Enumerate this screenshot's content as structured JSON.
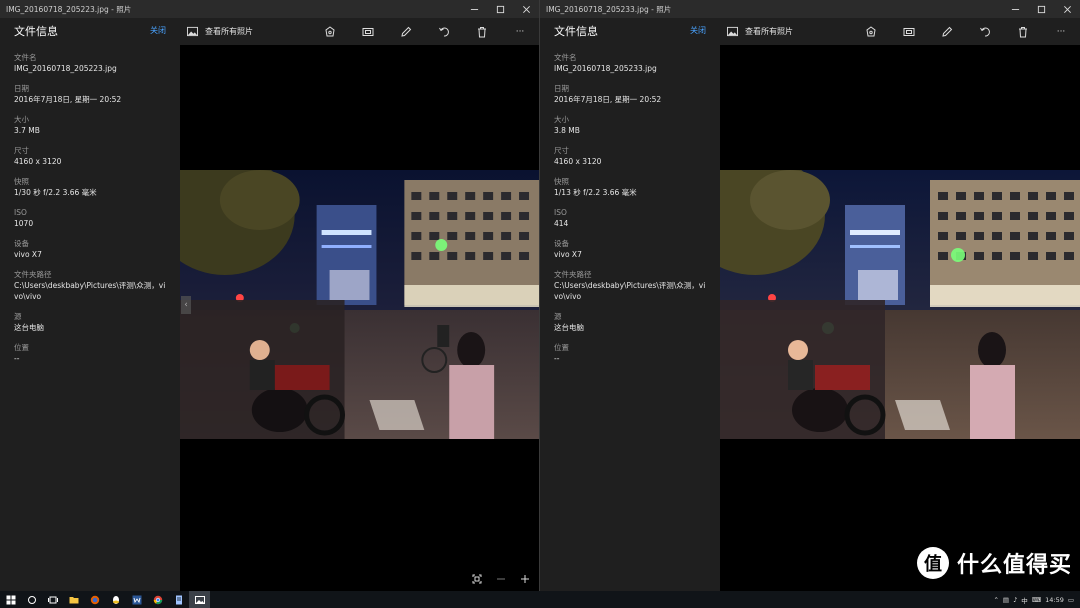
{
  "windows": [
    {
      "title": "IMG_20160718_205223.jpg - 照片",
      "panel_title": "文件信息",
      "close_label": "关闭",
      "view_all_label": "查看所有照片",
      "fields": [
        {
          "label": "文件名",
          "value": "IMG_20160718_205223.jpg"
        },
        {
          "label": "日期",
          "value": "2016年7月18日, 星期一 20:52"
        },
        {
          "label": "大小",
          "value": "3.7 MB"
        },
        {
          "label": "尺寸",
          "value": "4160 x 3120"
        },
        {
          "label": "快照",
          "value": "1/30 秒 f/2.2 3.66 毫米"
        },
        {
          "label": "ISO",
          "value": "1070"
        },
        {
          "label": "设备",
          "value": "vivo X7"
        },
        {
          "label": "文件夹路径",
          "value": "C:\\Users\\deskbaby\\Pictures\\评测\\众测，vivo\\vivo"
        },
        {
          "label": "源",
          "value": "这台电脑"
        },
        {
          "label": "位置",
          "value": "--"
        }
      ]
    },
    {
      "title": "IMG_20160718_205233.jpg - 照片",
      "panel_title": "文件信息",
      "close_label": "关闭",
      "view_all_label": "查看所有照片",
      "fields": [
        {
          "label": "文件名",
          "value": "IMG_20160718_205233.jpg"
        },
        {
          "label": "日期",
          "value": "2016年7月18日, 星期一 20:52"
        },
        {
          "label": "大小",
          "value": "3.8 MB"
        },
        {
          "label": "尺寸",
          "value": "4160 x 3120"
        },
        {
          "label": "快照",
          "value": "1/13 秒 f/2.2 3.66 毫米"
        },
        {
          "label": "ISO",
          "value": "414"
        },
        {
          "label": "设备",
          "value": "vivo X7"
        },
        {
          "label": "文件夹路径",
          "value": "C:\\Users\\deskbaby\\Pictures\\评测\\众测，vivo\\vivo"
        },
        {
          "label": "源",
          "value": "这台电脑"
        },
        {
          "label": "位置",
          "value": "--"
        }
      ]
    }
  ],
  "toolbar_icons": [
    "enhance-icon",
    "slideshow-icon",
    "edit-icon",
    "rotate-icon",
    "delete-icon",
    "more-icon"
  ],
  "more_glyph": "···",
  "taskbar": {
    "apps": [
      "start-icon",
      "cortana-icon",
      "task-view-icon",
      "file-explorer-icon",
      "firefox-icon",
      "qq-icon",
      "word-icon",
      "chrome-icon",
      "notepad-icon",
      "photos-icon"
    ],
    "tray_ime": "中",
    "clock": "14:59"
  },
  "watermark": {
    "logo_glyph": "值",
    "text": "什么值得买"
  },
  "colors": {
    "accent": "#4aa3ff",
    "panel_bg": "#1f1f1f",
    "titlebar_bg": "#2b2b2b",
    "taskbar_bg": "#101418"
  }
}
